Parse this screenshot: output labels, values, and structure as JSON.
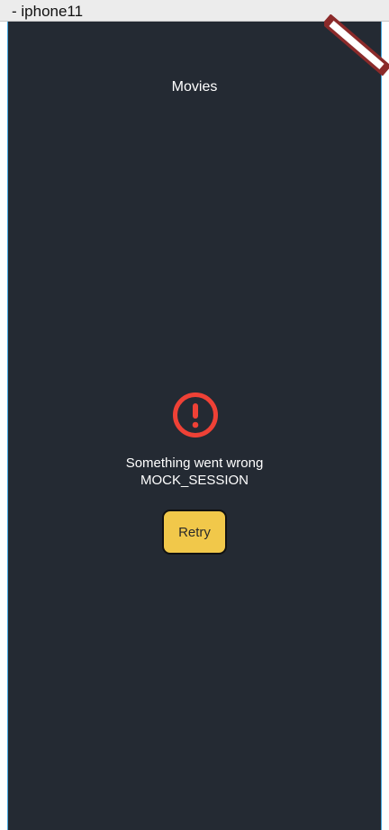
{
  "window": {
    "title": "- iphone11"
  },
  "screen": {
    "title": "Movies"
  },
  "error": {
    "icon": "exclamation-circle-icon",
    "message": "Something went wrong",
    "detail": "MOCK_SESSION"
  },
  "actions": {
    "retry_label": "Retry"
  },
  "colors": {
    "background": "#242a33",
    "error": "#ef4136",
    "button": "#f1c84a",
    "banner": "#8b2a2a",
    "frame_border": "#47a7de"
  }
}
